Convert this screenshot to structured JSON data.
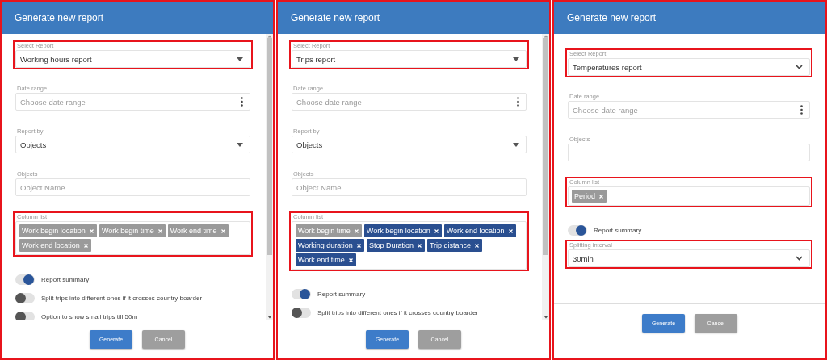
{
  "panels": [
    {
      "title": "Generate new report",
      "scrollbar": true,
      "fields": [
        {
          "kind": "select",
          "label": "Select Report",
          "value": "Working hours report",
          "highlighted": true
        },
        {
          "kind": "date",
          "label": "Date range",
          "placeholder": "Choose date range",
          "highlighted": false
        },
        {
          "kind": "select",
          "label": "Report by",
          "value": "Objects",
          "highlighted": false
        },
        {
          "kind": "input",
          "label": "Objects",
          "placeholder": "Object Name",
          "highlighted": false
        },
        {
          "kind": "chips",
          "label": "Column list",
          "highlighted": true,
          "chips": [
            {
              "text": "Work begin location",
              "selected": false
            },
            {
              "text": "Work begin time",
              "selected": false
            },
            {
              "text": "Work end time",
              "selected": false
            },
            {
              "text": "Work end location",
              "selected": false
            }
          ]
        },
        {
          "kind": "toggle",
          "label": "Report summary",
          "on": true
        },
        {
          "kind": "toggle",
          "label": "Split trips into different ones if it crosses country boarder",
          "on": false
        },
        {
          "kind": "toggle",
          "label": "Option to show small trips till 50m",
          "on": false
        }
      ],
      "buttons": [
        {
          "label": "Generate",
          "kind": "primary"
        },
        {
          "label": "Cancel",
          "kind": "secondary"
        }
      ]
    },
    {
      "title": "Generate new report",
      "scrollbar": true,
      "fields": [
        {
          "kind": "select",
          "label": "Select Report",
          "value": "Trips report",
          "highlighted": true
        },
        {
          "kind": "date",
          "label": "Date range",
          "placeholder": "Choose date range",
          "highlighted": false
        },
        {
          "kind": "select",
          "label": "Report by",
          "value": "Objects",
          "highlighted": false
        },
        {
          "kind": "input",
          "label": "Objects",
          "placeholder": "Object Name",
          "highlighted": false
        },
        {
          "kind": "chips",
          "label": "Column list",
          "highlighted": true,
          "chips": [
            {
              "text": "Work begin time",
              "selected": false
            },
            {
              "text": "Work begin location",
              "selected": true
            },
            {
              "text": "Work end location",
              "selected": true
            },
            {
              "text": "Working duration",
              "selected": true
            },
            {
              "text": "Stop Duration",
              "selected": true
            },
            {
              "text": "Trip distance",
              "selected": true
            },
            {
              "text": "Work end time",
              "selected": true
            }
          ]
        },
        {
          "kind": "toggle",
          "label": "Report summary",
          "on": true
        },
        {
          "kind": "toggle",
          "label": "Split trips into different ones if it crosses country boarder",
          "on": false
        }
      ],
      "buttons": [
        {
          "label": "Generate",
          "kind": "primary"
        },
        {
          "label": "Cancel",
          "kind": "secondary"
        }
      ]
    },
    {
      "title": "Generate new report",
      "scrollbar": false,
      "fields": [
        {
          "kind": "dropdown",
          "label": "Select Report",
          "value": "Temperatures report",
          "highlighted": true
        },
        {
          "kind": "date",
          "label": "Date range",
          "placeholder": "Choose date range",
          "highlighted": false
        },
        {
          "kind": "input",
          "label": "Objects",
          "highlighted": false
        },
        {
          "kind": "chips",
          "label": "Column list",
          "highlighted": true,
          "chips": [
            {
              "text": "Period",
              "selected": false
            }
          ]
        },
        {
          "kind": "toggle",
          "label": "Report summary",
          "on": true
        },
        {
          "kind": "dropdown",
          "label": "Splitting interval",
          "value": "30min",
          "highlighted": true
        }
      ],
      "buttons": [
        {
          "label": "Generate",
          "kind": "primary"
        },
        {
          "label": "Cancel",
          "kind": "secondary"
        }
      ]
    }
  ]
}
